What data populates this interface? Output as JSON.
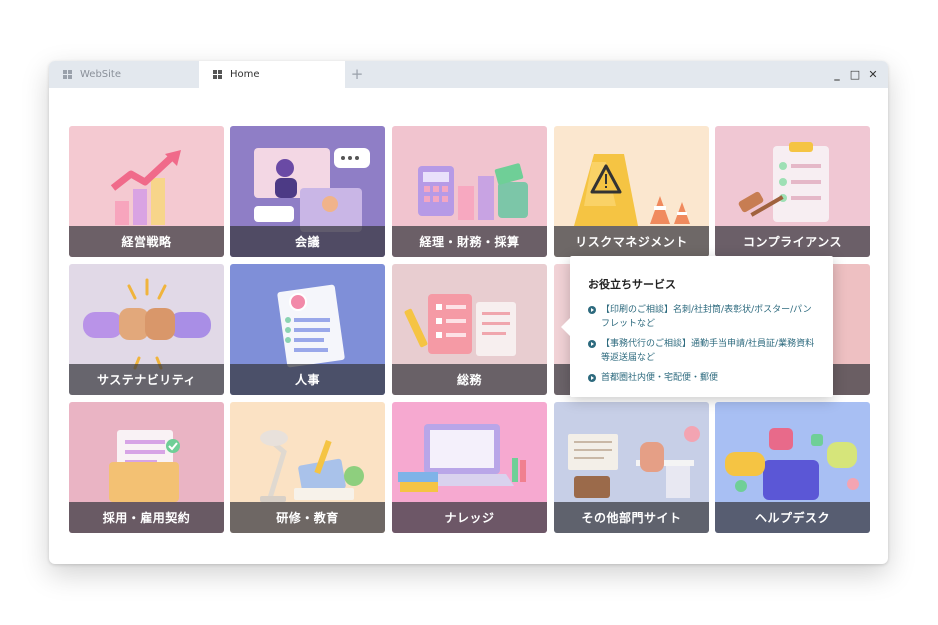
{
  "window": {
    "tabs": [
      {
        "label": "WebSite",
        "active": false
      },
      {
        "label": "Home",
        "active": true
      }
    ],
    "new_tab_symbol": "+",
    "controls": {
      "minimize": "_",
      "maximize": "□",
      "close": "✕"
    }
  },
  "tiles": [
    {
      "label": "経営戦略",
      "color": "#f4c9d1"
    },
    {
      "label": "会議",
      "color": "#8f7ec6"
    },
    {
      "label": "経理・財務・採算",
      "color": "#f1c4cf"
    },
    {
      "label": "リスクマネジメント",
      "color": "#fbe7cf"
    },
    {
      "label": "コンプライアンス",
      "color": "#f0c7d3"
    },
    {
      "label": "サステナビリティ",
      "color": "#e1d9e7"
    },
    {
      "label": "人事",
      "color": "#7f8fd8"
    },
    {
      "label": "総務",
      "color": "#e8cdd0"
    },
    {
      "label": "採用・雇用契約",
      "color": "#eab4c4"
    },
    {
      "label": "研修・教育",
      "color": "#fbe2c4"
    },
    {
      "label": "ナレッジ",
      "color": "#f6a9d0"
    },
    {
      "label": "その他部門サイト",
      "color": "#c7cfe7"
    },
    {
      "label": "ヘルプデスク",
      "color": "#a8bff3"
    }
  ],
  "popup": {
    "title": "お役立ちサービス",
    "items": [
      "【印刷のご相談】名刺/社封筒/表彰状/ポスター/パンフレットなど",
      "【事務代行のご相談】通勤手当申請/社員証/業務資料等返送届など",
      "首都圏社内便・宅配便・郵便"
    ]
  }
}
